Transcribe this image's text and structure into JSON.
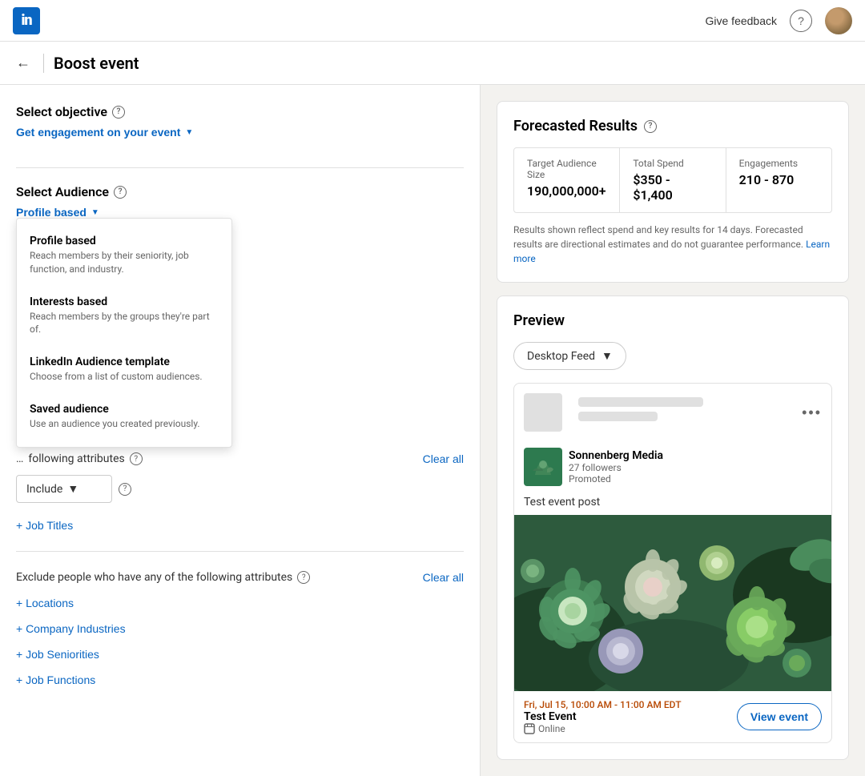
{
  "nav": {
    "logo_text": "in",
    "give_feedback": "Give feedback",
    "help_icon": "?",
    "page_title": "Boost event"
  },
  "left_panel": {
    "objective_label": "Select objective",
    "objective_value": "Get engagement on your event",
    "audience_label": "Select Audience",
    "audience_value": "Profile based",
    "attributes_label": "following attributes",
    "clear_all": "Clear all",
    "exclude_label": "Exclude people who have any of the following attributes",
    "exclude_clear_all": "Clear all",
    "add_locations": "+ Locations",
    "add_company_industries": "+ Company Industries",
    "add_job_seniorities": "+ Job Seniorities",
    "add_job_functions": "+ Job Functions",
    "add_job_titles": "+ Job Titles"
  },
  "dropdown_menu": {
    "items": [
      {
        "title": "Profile based",
        "desc": "Reach members by their seniority, job function, and industry."
      },
      {
        "title": "Interests based",
        "desc": "Reach members by the groups they're part of."
      },
      {
        "title": "LinkedIn Audience template",
        "desc": "Choose from a list of custom audiences."
      },
      {
        "title": "Saved audience",
        "desc": "Use an audience you created previously."
      }
    ]
  },
  "forecasted": {
    "title": "Forecasted Results",
    "metrics": [
      {
        "label": "Target Audience Size",
        "value": "190,000,000+"
      },
      {
        "label": "Total Spend",
        "value": "$350 - $1,400"
      },
      {
        "label": "Engagements",
        "value": "210 - 870"
      }
    ],
    "note": "Results shown reflect spend and key results for 14 days. Forecasted results are directional estimates and do not guarantee performance.",
    "learn_more": "Learn more"
  },
  "preview": {
    "title": "Preview",
    "feed_option": "Desktop Feed",
    "post": {
      "author_name": "Sonnenberg Media",
      "author_followers": "27 followers",
      "author_promoted": "Promoted",
      "body_text": "Test event post",
      "event_date": "Fri, Jul 15, 10:00 AM - 11:00 AM EDT",
      "event_title": "Test Event",
      "event_location": "Online",
      "view_event_btn": "View event"
    }
  }
}
